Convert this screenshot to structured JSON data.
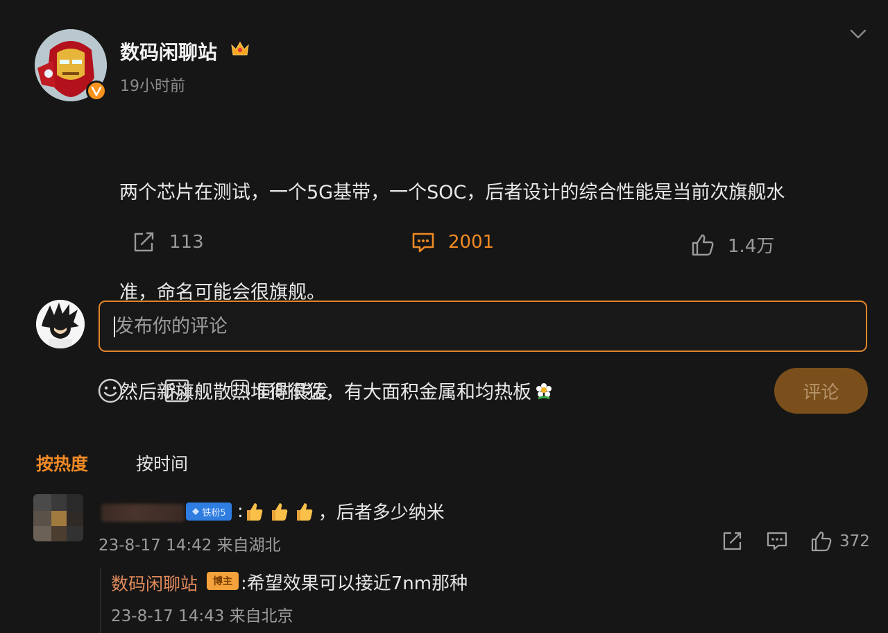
{
  "post": {
    "author": "数码闲聊站",
    "time_ago": "19小时前",
    "lines": [
      "两个芯片在测试，一个5G基带，一个SOC，后者设计的综合性能是当前次旗舰水",
      "准，命名可能会很旗舰。",
      "然后新旗舰散热堆得很猛，有大面积金属和均热板"
    ],
    "verified_icon": "v-verified-badge",
    "crown_icon": "crown-icon",
    "trailing_emoji": "flower-emoji"
  },
  "actions": {
    "share_count": "113",
    "comment_count": "2001",
    "like_count": "1.4万"
  },
  "composer": {
    "placeholder": "发布你的评论",
    "repost_label": "同时转发",
    "repost_checked": false,
    "submit_label": "评论"
  },
  "sort_tabs": {
    "hot_label": "按热度",
    "time_label": "按时间",
    "active": "hot"
  },
  "comments": [
    {
      "fan_badge": "铁粉5",
      "text": "，后者多少纳米",
      "emoji": [
        "thumbs-up-emoji",
        "thumbs-up-emoji",
        "thumbs-up-emoji"
      ],
      "meta": "23-8-17 14:42 来自湖北",
      "like_count": "372",
      "reply": {
        "author": "数码闲聊站",
        "badge": "博主",
        "text": ":希望效果可以接近7nm那种",
        "meta": "23-8-17 14:43 来自北京"
      }
    }
  ],
  "colors": {
    "background": "#161616",
    "accent": "#f08a24",
    "input_border": "#e1852b",
    "submit_bg": "#7a4f1c",
    "reply_author": "#e0895b"
  }
}
